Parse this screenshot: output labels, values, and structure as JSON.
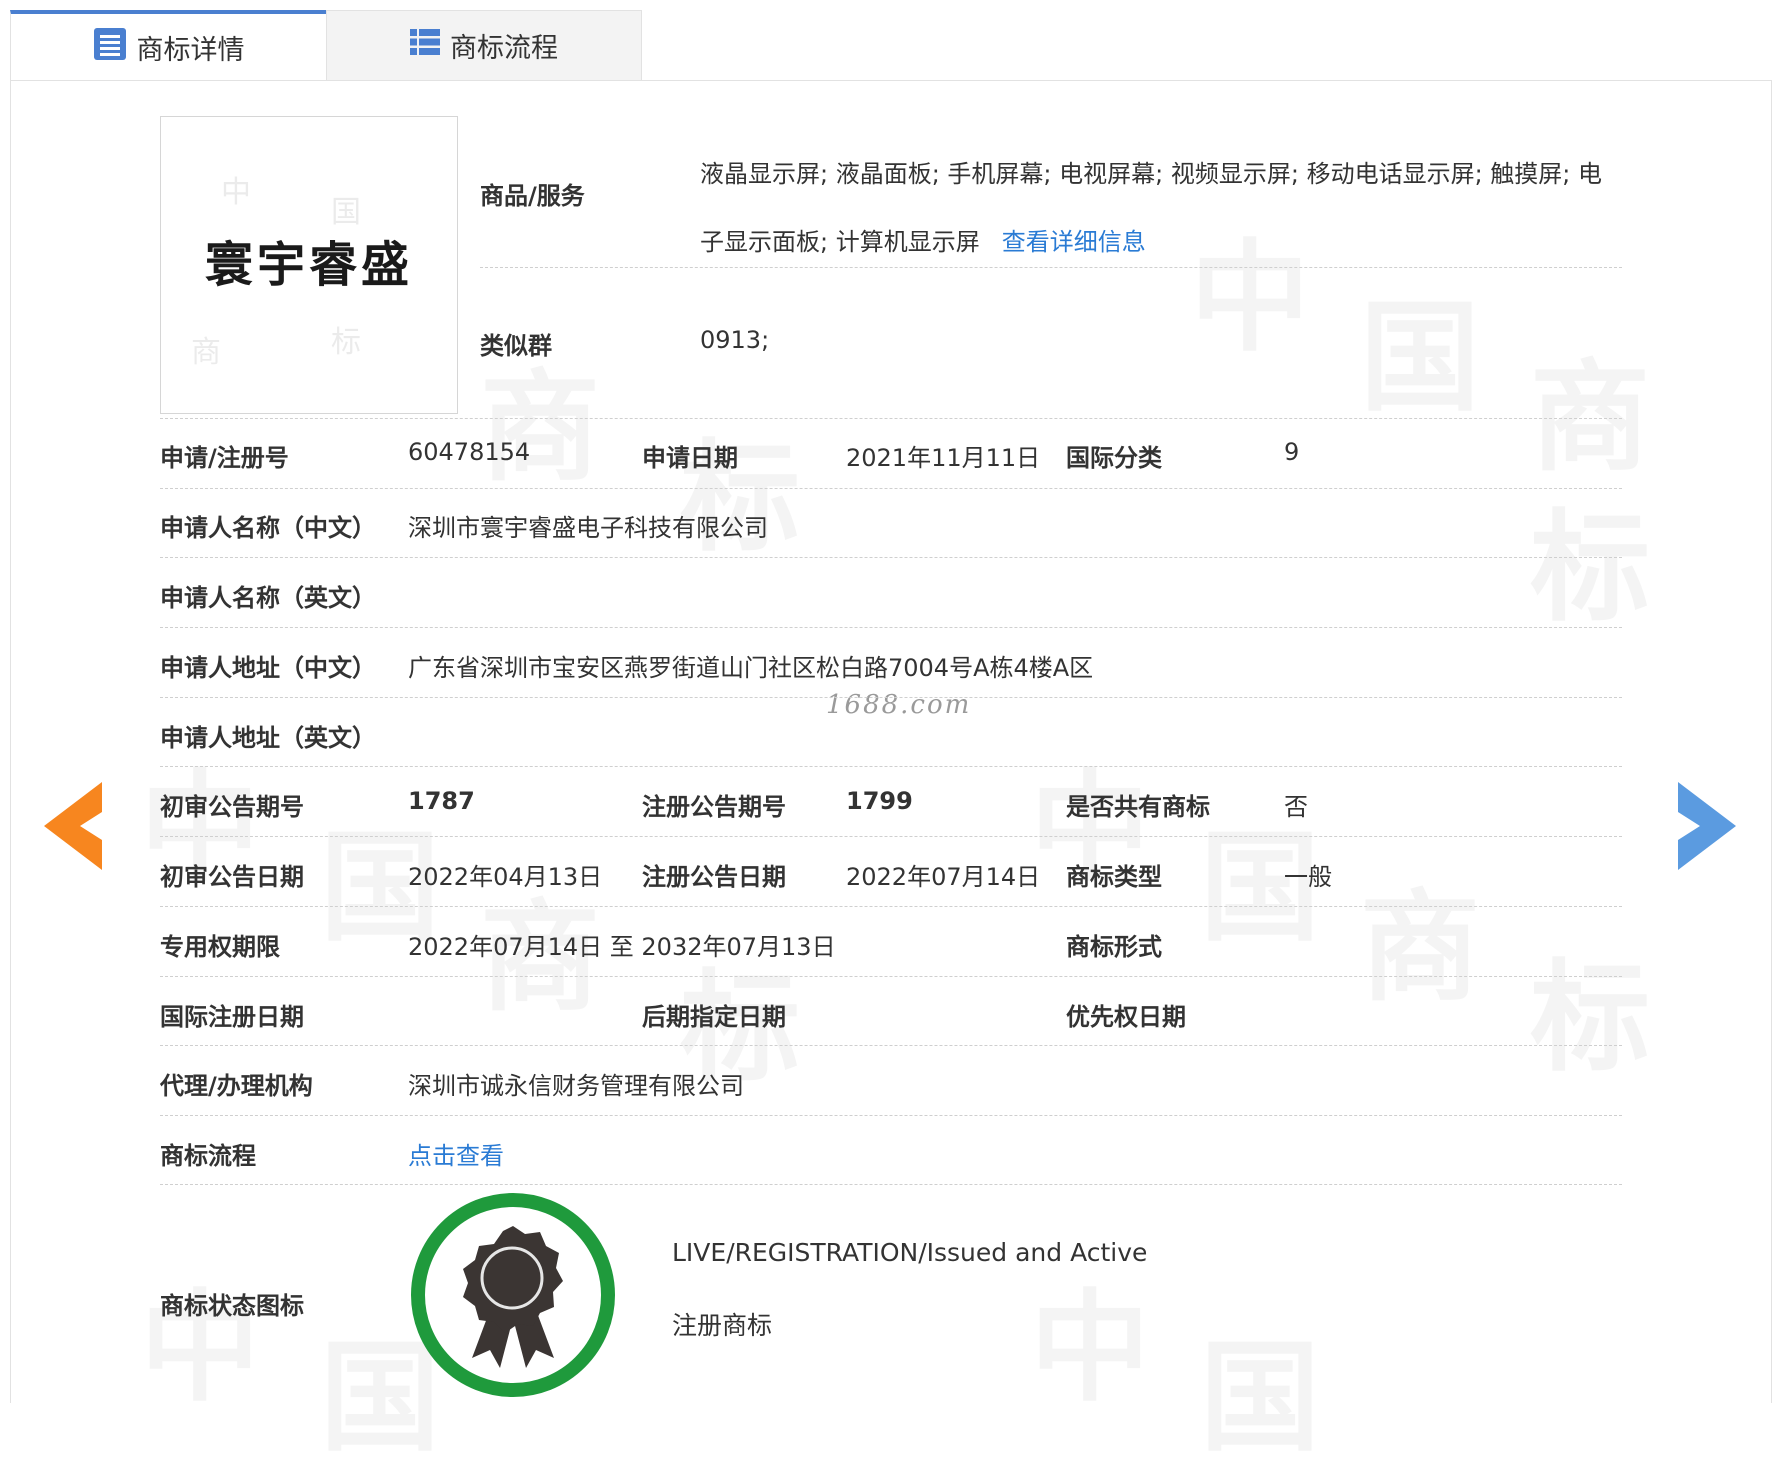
{
  "tabs": {
    "details_label": "商标详情",
    "process_label": "商标流程"
  },
  "watermark": {
    "site": "1688.com"
  },
  "trademark": {
    "name": "寰宇睿盛"
  },
  "goods": {
    "label": "商品/服务",
    "items": "液晶显示屏; 液晶面板; 手机屏幕; 电视屏幕; 视频显示屏; 移动电话显示屏; 触摸屏; 电子显示面板; 计算机显示屏",
    "detail_link": "查看详细信息"
  },
  "similar_group": {
    "label": "类似群",
    "value": "0913;"
  },
  "fields": {
    "reg_no_label": "申请/注册号",
    "reg_no": "60478154",
    "apply_date_label": "申请日期",
    "apply_date": "2021年11月11日",
    "intl_class_label": "国际分类",
    "intl_class": "9",
    "applicant_cn_label": "申请人名称（中文）",
    "applicant_cn": "深圳市寰宇睿盛电子科技有限公司",
    "applicant_en_label": "申请人名称（英文）",
    "applicant_en": "",
    "address_cn_label": "申请人地址（中文）",
    "address_cn": "广东省深圳市宝安区燕罗街道山门社区松白路7004号A栋4楼A区",
    "address_en_label": "申请人地址（英文）",
    "address_en": "",
    "prelim_issue_label": "初审公告期号",
    "prelim_issue": "1787",
    "reg_issue_label": "注册公告期号",
    "reg_issue": "1799",
    "shared_label": "是否共有商标",
    "shared": "否",
    "prelim_date_label": "初审公告日期",
    "prelim_date": "2022年04月13日",
    "reg_date_label": "注册公告日期",
    "reg_date": "2022年07月14日",
    "tm_type_label": "商标类型",
    "tm_type": "一般",
    "exclusive_label": "专用权期限",
    "exclusive": "2022年07月14日 至 2032年07月13日",
    "tm_form_label": "商标形式",
    "tm_form": "",
    "intl_reg_date_label": "国际注册日期",
    "later_date_label": "后期指定日期",
    "priority_date_label": "优先权日期",
    "agent_label": "代理/办理机构",
    "agent": "深圳市诚永信财务管理有限公司",
    "process_label": "商标流程",
    "process_link": "点击查看",
    "status_icon_label": "商标状态图标"
  },
  "status": {
    "en": "LIVE/REGISTRATION/Issued and Active",
    "cn": "注册商标"
  },
  "colors": {
    "accent_blue": "#4a7fd0",
    "link_blue": "#2a7bd4",
    "prev_arrow": "#f7861f",
    "next_arrow": "#5b9be0",
    "status_ring": "#1f9a3c"
  }
}
